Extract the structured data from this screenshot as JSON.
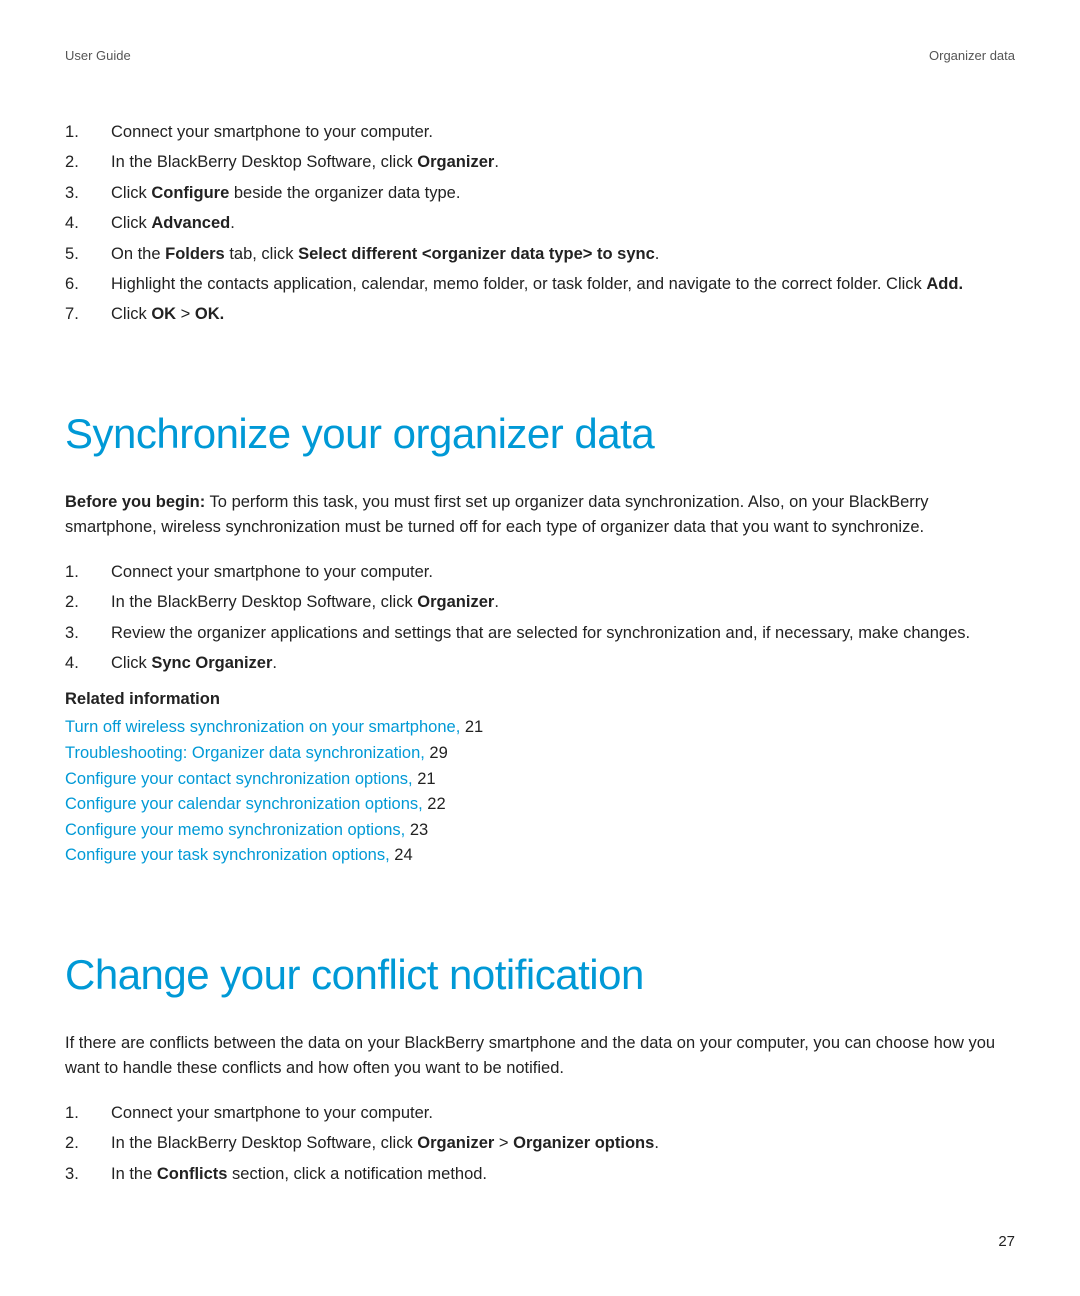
{
  "header": {
    "left": "User Guide",
    "right": "Organizer data"
  },
  "topSteps": {
    "s1": "Connect your smartphone to your computer.",
    "s2_pre": "In the BlackBerry Desktop Software, click ",
    "s2_bold": "Organizer",
    "s2_post": ".",
    "s3_pre": "Click ",
    "s3_bold": "Configure",
    "s3_post": " beside the organizer data type.",
    "s4_pre": "Click ",
    "s4_bold": "Advanced",
    "s4_post": ".",
    "s5_pre": "On the ",
    "s5_b1": "Folders",
    "s5_mid1": " tab, click ",
    "s5_b2": "Select different <organizer data type> to sync",
    "s5_post": ".",
    "s6_pre": "Highlight the contacts application, calendar, memo folder, or task folder, and navigate to the correct folder. Click ",
    "s6_bold": "Add.",
    "s7_pre": "Click ",
    "s7_b1": "OK",
    "s7_mid": " > ",
    "s7_b2": "OK."
  },
  "sec1": {
    "title": "Synchronize your organizer data",
    "intro_b": "Before you begin:",
    "intro_rest": " To perform this task, you must first set up organizer data synchronization. Also, on your BlackBerry smartphone, wireless synchronization must be turned off for each type of organizer data that you want to synchronize.",
    "s1": "Connect your smartphone to your computer.",
    "s2_pre": "In the BlackBerry Desktop Software, click ",
    "s2_bold": "Organizer",
    "s2_post": ".",
    "s3": "Review the organizer applications and settings that are selected for synchronization and, if necessary, make changes.",
    "s4_pre": "Click ",
    "s4_bold": "Sync Organizer",
    "s4_post": ".",
    "related_heading": "Related information",
    "related": [
      {
        "text": "Turn off wireless synchronization on your smartphone,",
        "page": " 21"
      },
      {
        "text": "Troubleshooting: Organizer data synchronization,",
        "page": " 29"
      },
      {
        "text": "Configure your contact synchronization options,",
        "page": " 21"
      },
      {
        "text": "Configure your calendar synchronization options,",
        "page": " 22"
      },
      {
        "text": "Configure your memo synchronization options,",
        "page": " 23"
      },
      {
        "text": "Configure your task synchronization options,",
        "page": " 24"
      }
    ]
  },
  "sec2": {
    "title": "Change your conflict notification",
    "intro": "If there are conflicts between the data on your BlackBerry smartphone and the data on your computer, you can choose how you want to handle these conflicts and how often you want to be notified.",
    "s1": "Connect your smartphone to your computer.",
    "s2_pre": "In the BlackBerry Desktop Software, click ",
    "s2_b1": "Organizer",
    "s2_mid": " > ",
    "s2_b2": "Organizer options",
    "s2_post": ".",
    "s3_pre": "In the ",
    "s3_bold": "Conflicts",
    "s3_post": " section, click a notification method."
  },
  "pageNumber": "27"
}
